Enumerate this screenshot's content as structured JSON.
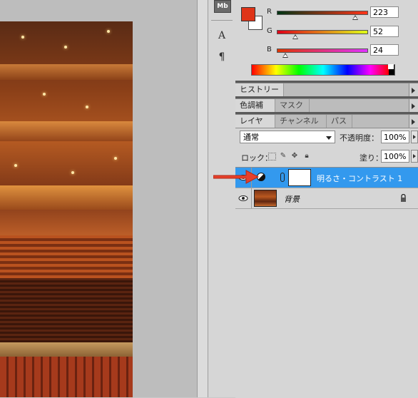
{
  "tool_strip": {
    "mb_label": "Mb"
  },
  "color_panel": {
    "foreground_color": "#df3418",
    "background_color": "#ffffff",
    "channels": [
      {
        "label": "R",
        "value": "223",
        "fraction": 0.874
      },
      {
        "label": "G",
        "value": "52",
        "fraction": 0.204
      },
      {
        "label": "B",
        "value": "24",
        "fraction": 0.094
      }
    ]
  },
  "tabs": {
    "history": [
      "ヒストリー"
    ],
    "adjust": [
      "色調補正",
      "マスク"
    ],
    "layers": [
      "レイヤー",
      "チャンネル",
      "パス"
    ]
  },
  "layer_controls": {
    "blend_mode": "通常",
    "opacity_label": "不透明度：",
    "opacity_value": "100%",
    "lock_label": "ロック：",
    "fill_label": "塗り：",
    "fill_value": "100%"
  },
  "layers": [
    {
      "name": "明るさ・コントラスト 1",
      "selected": true,
      "type": "adjustment"
    },
    {
      "name": "背景",
      "selected": false,
      "type": "background",
      "locked": true
    }
  ],
  "colors": {
    "selection": "#3399ee",
    "annotation_arrow": "#e8402a"
  }
}
